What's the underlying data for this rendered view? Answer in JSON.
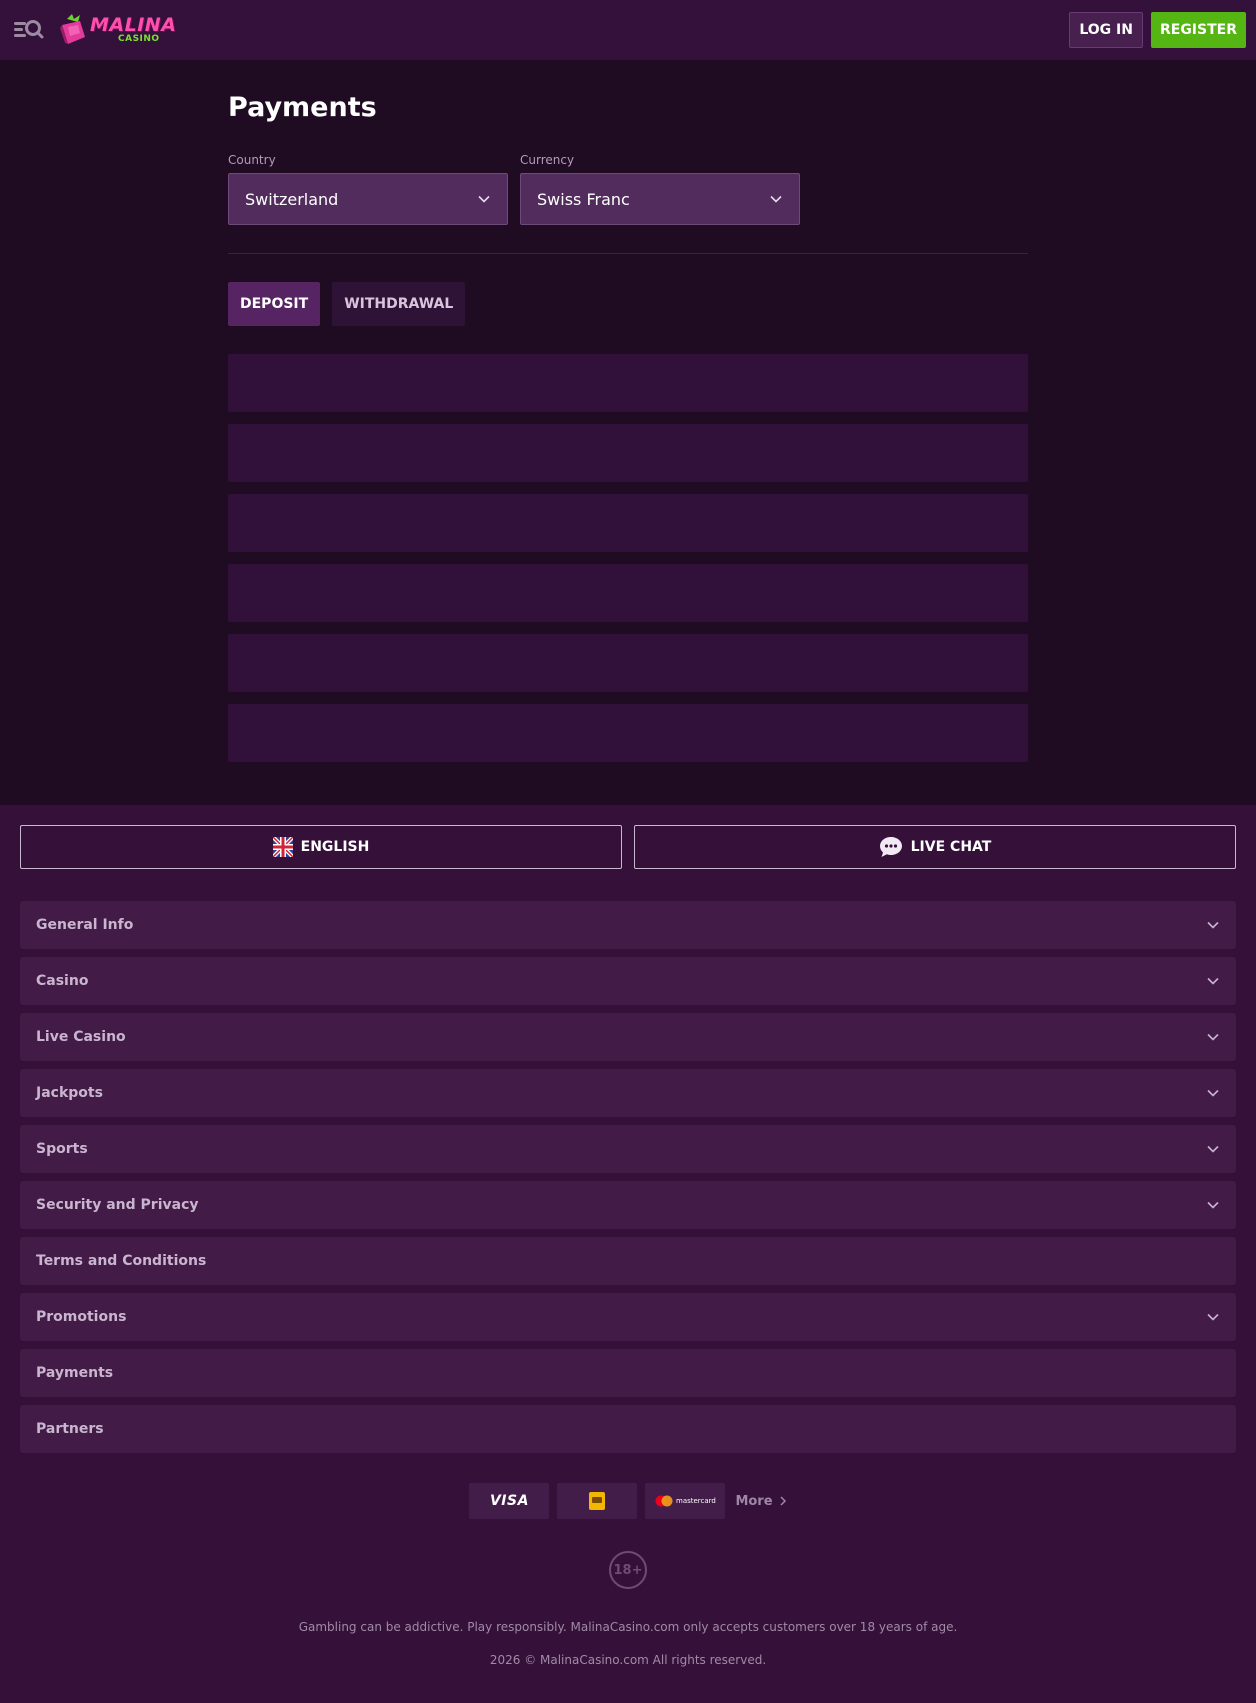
{
  "header": {
    "logo_title": "MALINA",
    "logo_subtitle": "CASINO",
    "login_label": "LOG IN",
    "register_label": "REGISTER"
  },
  "main": {
    "title": "Payments",
    "country": {
      "label": "Country",
      "value": "Switzerland"
    },
    "currency": {
      "label": "Currency",
      "value": "Swiss Franc"
    },
    "tabs": [
      {
        "label": "DEPOSIT",
        "active": true
      },
      {
        "label": "WITHDRAWAL",
        "active": false
      }
    ],
    "method_rows_count": 6
  },
  "footer": {
    "language_label": "ENGLISH",
    "chat_label": "LIVE CHAT",
    "sections": [
      {
        "label": "General Info",
        "expandable": true
      },
      {
        "label": "Casino",
        "expandable": true
      },
      {
        "label": "Live Casino",
        "expandable": true
      },
      {
        "label": "Jackpots",
        "expandable": true
      },
      {
        "label": "Sports",
        "expandable": true
      },
      {
        "label": "Security and Privacy",
        "expandable": true
      },
      {
        "label": "Terms and Conditions",
        "expandable": false
      },
      {
        "label": "Promotions",
        "expandable": true
      },
      {
        "label": "Payments",
        "expandable": false
      },
      {
        "label": "Partners",
        "expandable": false
      }
    ],
    "payment_logos": {
      "visa": "VISA",
      "mastercard": "mastercard"
    },
    "more_label": "More",
    "age_badge": "18+",
    "disclaimer": "Gambling can be addictive. Play responsibly. MalinaCasino.com only accepts customers over 18 years of age.",
    "copyright": "2026 © MalinaCasino.com All rights reserved."
  },
  "colors": {
    "page_bg": "#1f0b22",
    "header_bg": "#33113a",
    "register_green": "#55b512",
    "logo_pink": "#ff4fae",
    "footer_bg": "#35113a"
  }
}
